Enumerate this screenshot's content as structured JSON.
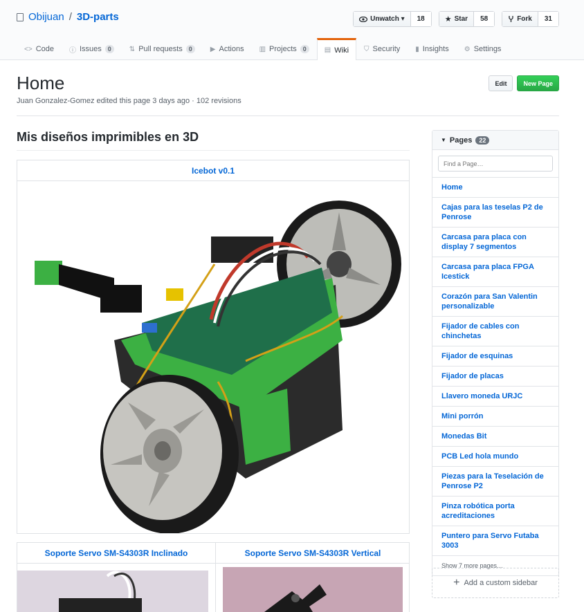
{
  "repo": {
    "owner": "Obijuan",
    "separator": "/",
    "name": "3D-parts"
  },
  "actions": [
    {
      "label": "Unwatch ▾",
      "icon": "eye-icon",
      "count": "18"
    },
    {
      "label": "Star",
      "icon": "star-icon",
      "count": "58"
    },
    {
      "label": "Fork",
      "icon": "fork-icon",
      "count": "31"
    }
  ],
  "tabs": [
    {
      "label": "Code",
      "icon": "<>"
    },
    {
      "label": "Issues",
      "icon": "ⓘ",
      "badge": "0"
    },
    {
      "label": "Pull requests",
      "icon": "⇅",
      "badge": "0"
    },
    {
      "label": "Actions",
      "icon": "▶"
    },
    {
      "label": "Projects",
      "icon": "▥",
      "badge": "0"
    },
    {
      "label": "Wiki",
      "icon": "▤"
    },
    {
      "label": "Security",
      "icon": "⛉"
    },
    {
      "label": "Insights",
      "icon": "▮"
    },
    {
      "label": "Settings",
      "icon": "⚙"
    }
  ],
  "page": {
    "title": "Home",
    "meta": "Juan Gonzalez-Gomez edited this page 3 days ago · 102 revisions",
    "edit_label": "Edit",
    "new_page_label": "New Page"
  },
  "content": {
    "heading": "Mis diseños imprimibles en 3D",
    "table1_header": "Icebot v0.1",
    "table2_headers": [
      "Soporte Servo SM-S4303R Inclinado",
      "Soporte Servo SM-S4303R Vertical"
    ]
  },
  "sidebar": {
    "title": "Pages",
    "count": "22",
    "search_placeholder": "Find a Page…",
    "items": [
      "Home",
      "Cajas para las teselas P2 de Penrose",
      "Carcasa para placa con display 7 segmentos",
      "Carcasa para placa FPGA Icestick",
      "Corazón para San Valentin personalizable",
      "Fijador de cables con chinchetas",
      "Fijador de esquinas",
      "Fijador de placas",
      "Llavero moneda URJC",
      "Mini porrón",
      "Monedas Bit",
      "PCB Led hola mundo",
      "Piezas para la Teselación de Penrose P2",
      "Pinza robótica porta acreditaciones",
      "Puntero para Servo Futaba 3003"
    ],
    "more": "Show 7 more pages…",
    "custom_sidebar": "Add a custom sidebar"
  },
  "colors": {
    "link": "#0366d6",
    "green": "#28a745",
    "tab_accent": "#e36209",
    "robot_green": "#3cb043"
  }
}
